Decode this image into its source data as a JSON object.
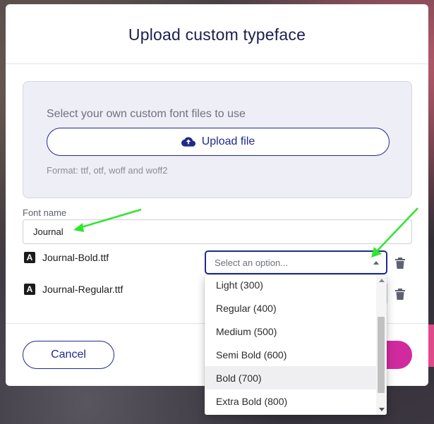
{
  "dialog": {
    "title": "Upload custom typeface"
  },
  "upload": {
    "prompt": "Select your own custom font files to use",
    "button_label": "Upload file",
    "format_hint": "Format: ttf, otf, woff and woff2"
  },
  "font_name": {
    "label": "Font name",
    "value": "Journal"
  },
  "files": [
    {
      "name": "Journal-Bold.ttf",
      "weight_placeholder": "Select an option..."
    },
    {
      "name": "Journal-Regular.ttf",
      "weight_placeholder": ""
    }
  ],
  "weight_dropdown": {
    "options": [
      "Light (300)",
      "Regular (400)",
      "Medium (500)",
      "Semi Bold (600)",
      "Bold (700)",
      "Extra Bold (800)"
    ],
    "highlighted": "Bold (700)"
  },
  "footer": {
    "cancel_label": "Cancel"
  },
  "colors": {
    "primary": "#1e2b8a",
    "accent": "#d12a9e",
    "annotation_arrow": "#2ee62e"
  }
}
